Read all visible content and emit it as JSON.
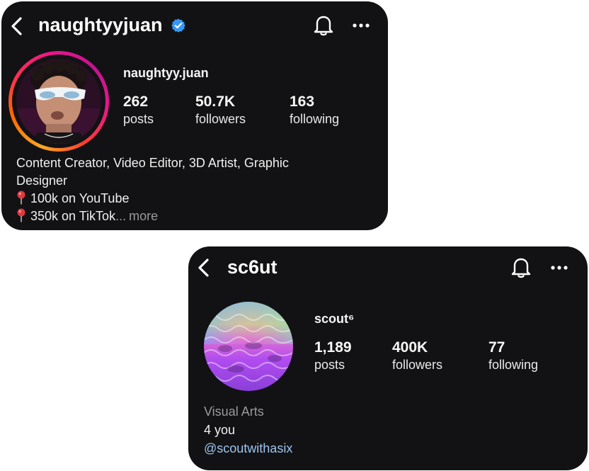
{
  "profile1": {
    "username": "naughtyyjuan",
    "verified": true,
    "display_name": "naughtyy.juan",
    "stats": [
      {
        "value": "262",
        "label": "posts"
      },
      {
        "value": "50.7K",
        "label": "followers"
      },
      {
        "value": "163",
        "label": "following"
      }
    ],
    "bio": {
      "line1": "Content Creator, Video Editor, 3D Artist, Graphic",
      "line2": "Designer",
      "line3": "100k on YouTube",
      "line4": "350k on TikTok",
      "ellipsis": "...",
      "more": "more"
    },
    "icons": {
      "back": "back-chevron-icon",
      "verified": "verified-badge-icon",
      "bell": "bell-icon",
      "more": "more-horizontal-icon",
      "pin": "pushpin-icon"
    }
  },
  "profile2": {
    "username": "sc6ut",
    "display_name": "scout⁶",
    "stats": [
      {
        "value": "1,189",
        "label": "posts"
      },
      {
        "value": "400K",
        "label": "followers"
      },
      {
        "value": "77",
        "label": "following"
      }
    ],
    "bio": {
      "category": "Visual Arts",
      "line1": "4 you",
      "link": "@scoutwithasix"
    },
    "icons": {
      "back": "back-chevron-icon",
      "bell": "bell-icon",
      "more": "more-horizontal-icon"
    }
  },
  "colors": {
    "card_bg": "#121215",
    "verified_blue": "#3897f0",
    "link_blue": "#9fc4ee",
    "muted_text": "#9a9a9a",
    "story_ring": [
      "#f9a825",
      "#ff3d2e",
      "#e8168b"
    ]
  }
}
